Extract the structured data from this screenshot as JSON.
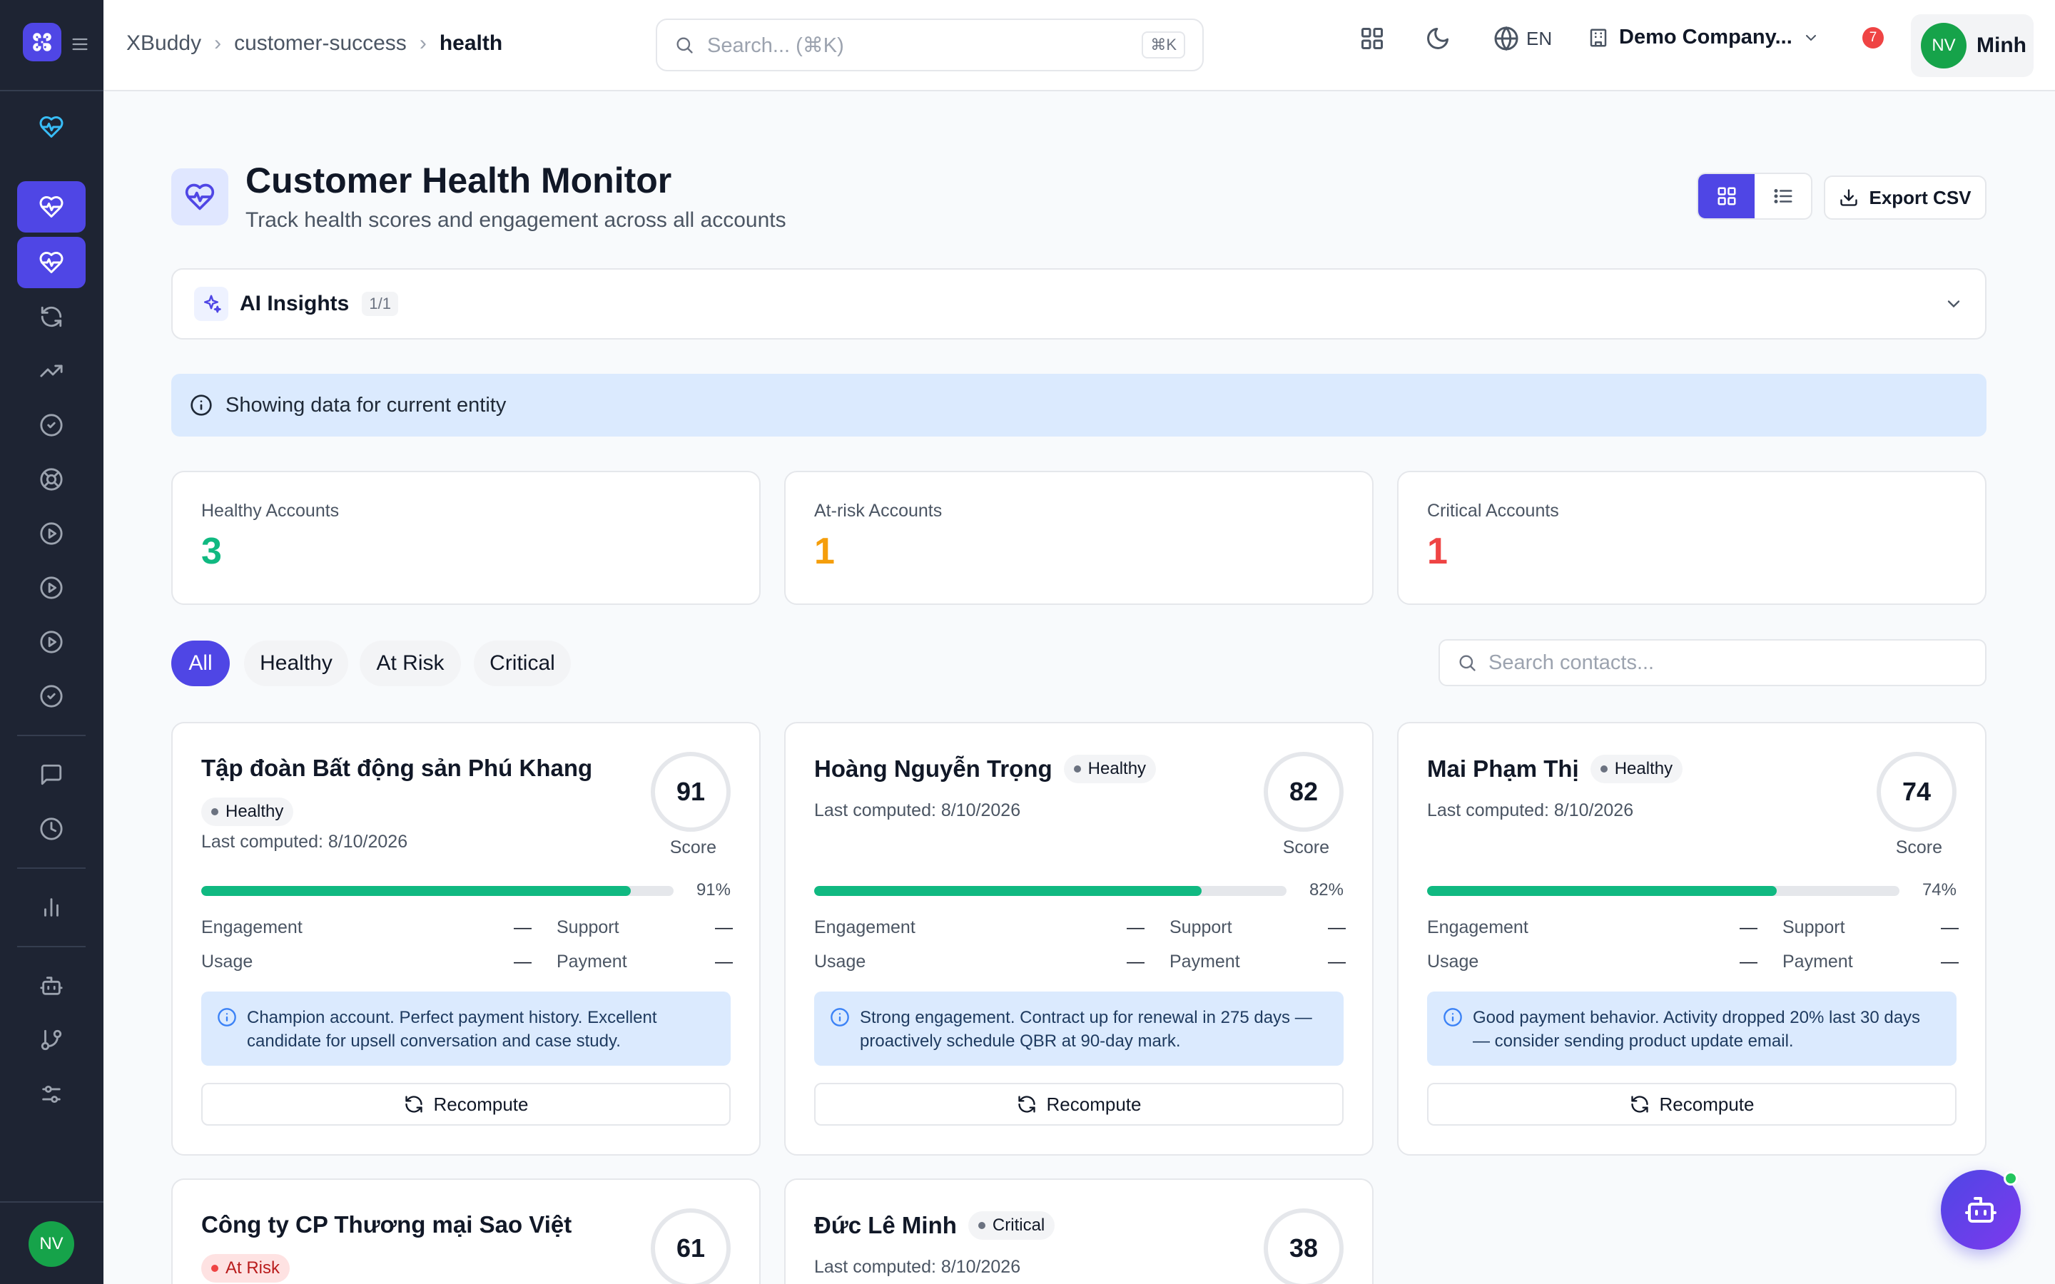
{
  "app": {
    "name": "XBuddy"
  },
  "breadcrumbs": [
    "XBuddy",
    "customer-success",
    "health"
  ],
  "search": {
    "placeholder": "Search... (⌘K)",
    "shortcut": "⌘K"
  },
  "header": {
    "language": "EN",
    "company": "Demo Company...",
    "notification_count": "7",
    "user_initials": "NV",
    "user_name": "Minh"
  },
  "sidebar": {
    "avatar_initials": "NV",
    "icons": [
      "heart-pulse-icon",
      "heart-pulse-icon",
      "heart-pulse-icon",
      "refresh-icon",
      "trending-up-icon",
      "check-circle-icon",
      "lifebuoy-icon",
      "play-circle-icon",
      "play-circle-icon",
      "play-circle-icon",
      "check-circle-icon",
      "message-square-icon",
      "clock-icon",
      "bar-chart-icon",
      "bot-icon",
      "git-branch-icon",
      "sliders-icon"
    ]
  },
  "page": {
    "title": "Customer Health Monitor",
    "subtitle": "Track health scores and engagement across all accounts",
    "export_label": "Export CSV"
  },
  "ai_insights": {
    "title": "AI Insights",
    "count": "1/1"
  },
  "banner": {
    "text": "Showing data for current entity"
  },
  "stats": [
    {
      "label": "Healthy Accounts",
      "value": "3",
      "color": "#10b981"
    },
    {
      "label": "At-risk Accounts",
      "value": "1",
      "color": "#f59e0b"
    },
    {
      "label": "Critical Accounts",
      "value": "1",
      "color": "#ef4444"
    }
  ],
  "filters": [
    "All",
    "Healthy",
    "At Risk",
    "Critical"
  ],
  "contact_search": {
    "placeholder": "Search contacts..."
  },
  "labels": {
    "score": "Score",
    "engagement": "Engagement",
    "support": "Support",
    "usage": "Usage",
    "payment": "Payment",
    "dash": "—",
    "recompute": "Recompute"
  },
  "accounts": [
    {
      "name": "Tập đoàn Bất động sản Phú Khang",
      "status": "Healthy",
      "computed": "Last computed: 8/10/2026",
      "score": "91",
      "percent_label": "91%",
      "percent": 91,
      "note": "Champion account. Perfect payment history. Excellent candidate for upsell conversation and case study."
    },
    {
      "name": "Hoàng Nguyễn Trọng",
      "status": "Healthy",
      "computed": "Last computed: 8/10/2026",
      "score": "82",
      "percent_label": "82%",
      "percent": 82,
      "note": "Strong engagement. Contract up for renewal in 275 days — proactively schedule QBR at 90-day mark."
    },
    {
      "name": "Mai Phạm Thị",
      "status": "Healthy",
      "computed": "Last computed: 8/10/2026",
      "score": "74",
      "percent_label": "74%",
      "percent": 74,
      "note": "Good payment behavior. Activity dropped 20% last 30 days — consider sending product update email."
    },
    {
      "name": "Công ty CP Thương mại Sao Việt",
      "status": "At Risk",
      "score": "61"
    },
    {
      "name": "Đức Lê Minh",
      "status": "Critical",
      "computed": "Last computed: 8/10/2026",
      "score": "38"
    }
  ]
}
